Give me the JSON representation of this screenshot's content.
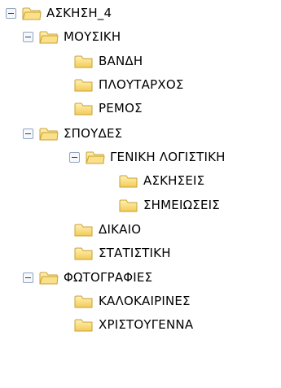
{
  "tree": {
    "root": {
      "label": "ΑΣΚΗΣΗ_4",
      "icon": "folder-icon",
      "children": [
        {
          "label": "ΜΟΥΣΙΚΗ",
          "children": [
            {
              "label": "ΒΑΝΔΗ"
            },
            {
              "label": "ΠΛΟΥΤΑΡΧΟΣ"
            },
            {
              "label": "ΡΕΜΟΣ"
            }
          ]
        },
        {
          "label": "ΣΠΟΥΔΕΣ",
          "children": [
            {
              "label": "ΓΕΝΙΚΗ ΛΟΓΙΣΤΙΚΗ",
              "children": [
                {
                  "label": "ΑΣΚΗΣΕΙΣ"
                },
                {
                  "label": "ΣΗΜΕΙΩΣΕΙΣ"
                }
              ]
            },
            {
              "label": "ΔΙΚΑΙΟ"
            },
            {
              "label": "ΣΤΑΤΙΣΤΙΚΗ"
            }
          ]
        },
        {
          "label": "ΦΩΤΟΓΡΑΦΙΕΣ",
          "children": [
            {
              "label": "ΚΑΛΟΚΑΙΡΙΝΕΣ"
            },
            {
              "label": "ΧΡΙΣΤΟΥΓΕΝΝΑ"
            }
          ]
        }
      ]
    },
    "colors": {
      "folder_fill": "#f7d774",
      "folder_stroke": "#c9a233",
      "toggle_border": "#8fa4c0",
      "toggle_sign": "#1f3f77"
    }
  }
}
